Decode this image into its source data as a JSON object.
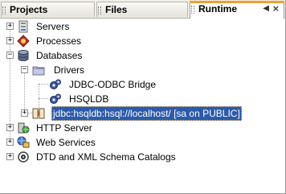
{
  "tabs": [
    {
      "label": "Projects"
    },
    {
      "label": "Files"
    },
    {
      "label": "Runtime"
    }
  ],
  "tab_controls": {
    "minimize_symbol": "◀",
    "close_symbol": "×"
  },
  "tree": {
    "items": [
      {
        "label": "Servers",
        "icon": "servers-icon",
        "expander": "+"
      },
      {
        "label": "Processes",
        "icon": "processes-icon",
        "expander": "+"
      },
      {
        "label": "Databases",
        "icon": "database-icon",
        "expander": "−"
      },
      {
        "label": "Drivers",
        "icon": "folder-icon",
        "expander": "−"
      },
      {
        "label": "JDBC-ODBC Bridge",
        "icon": "driver-icon"
      },
      {
        "label": "HSQLDB",
        "icon": "driver-icon"
      },
      {
        "label": "jdbc:hsqldb:hsql://localhost/ [sa on PUBLIC]",
        "icon": "connection-icon",
        "expander": "+",
        "selected": true
      },
      {
        "label": "HTTP Server",
        "icon": "http-server-icon",
        "expander": "+"
      },
      {
        "label": "Web Services",
        "icon": "web-services-icon",
        "expander": "+"
      },
      {
        "label": "DTD and XML Schema Catalogs",
        "icon": "xml-catalog-icon",
        "expander": "+"
      }
    ]
  },
  "colors": {
    "selection": "#2d5aab",
    "active_tab_accent": "#f0a030"
  }
}
